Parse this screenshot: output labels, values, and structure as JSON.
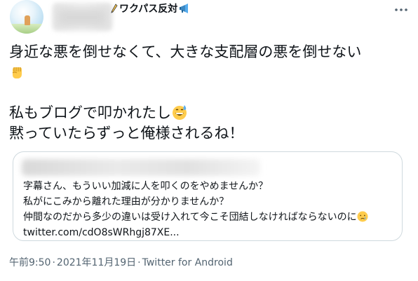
{
  "author": {
    "display_name_suffix": "ワクパス反対",
    "avatar": "avatar-image",
    "pencil_emoji": "pencil-icon",
    "megaphone_emoji": "megaphone-icon"
  },
  "more_menu": {
    "icon": "more-horizontal-icon"
  },
  "tweet": {
    "line1": "身近な悪を倒せなくて、大きな支配層の悪を倒せない",
    "line2": "私もブログで叩かれたし",
    "line3": "黙っていたらずっと俺様されるね！"
  },
  "quote": {
    "line1": "字幕さん、もういい加減に人を叩くのをやめませんか？",
    "line2": "私がにこみから離れた理由が分かりませんか？",
    "line3": "仲間なのだから多少の違いは受け入れて今こそ団結しなければならないのに",
    "link": "twitter.com/cdO8sWRhgj87XE..."
  },
  "meta": {
    "time": "午前9:50",
    "separator": "·",
    "date": "2021年11月19日",
    "source": "Twitter for Android"
  },
  "colors": {
    "text": "#0f1419",
    "secondary": "#536471",
    "border": "#cfd9de"
  }
}
